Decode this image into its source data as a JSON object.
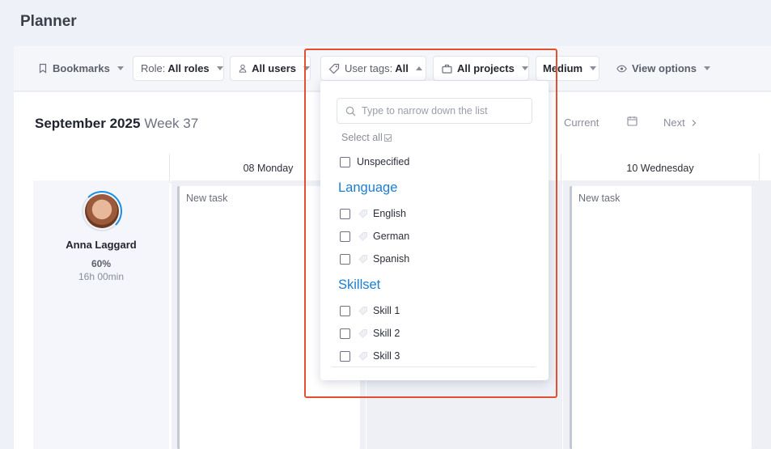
{
  "page_title": "Planner",
  "toolbar": {
    "bookmarks": "Bookmarks",
    "role_label": "Role:",
    "role_value": "All roles",
    "users": "All users",
    "user_tags_label": "User tags:",
    "user_tags_value": "All",
    "projects": "All projects",
    "size": "Medium",
    "view_options": "View options"
  },
  "header": {
    "month": "September 2025",
    "week": "Week 37",
    "current": "Current",
    "next": "Next"
  },
  "columns": [
    "08 Monday",
    "10 Wednesday"
  ],
  "tasks": [
    "New task",
    "New task"
  ],
  "user": {
    "name": "Anna Laggard",
    "percent": "60%",
    "hours": "16h 00min"
  },
  "dropdown": {
    "search_placeholder": "Type to narrow down the list",
    "select_all": "Select all",
    "unspecified": "Unspecified",
    "groups": [
      {
        "title": "Language",
        "items": [
          "English",
          "German",
          "Spanish"
        ]
      },
      {
        "title": "Skillset",
        "items": [
          "Skill 1",
          "Skill 2",
          "Skill 3"
        ]
      }
    ]
  },
  "colors": {
    "accent": "#1a7fd4",
    "highlight": "#e4502f"
  }
}
